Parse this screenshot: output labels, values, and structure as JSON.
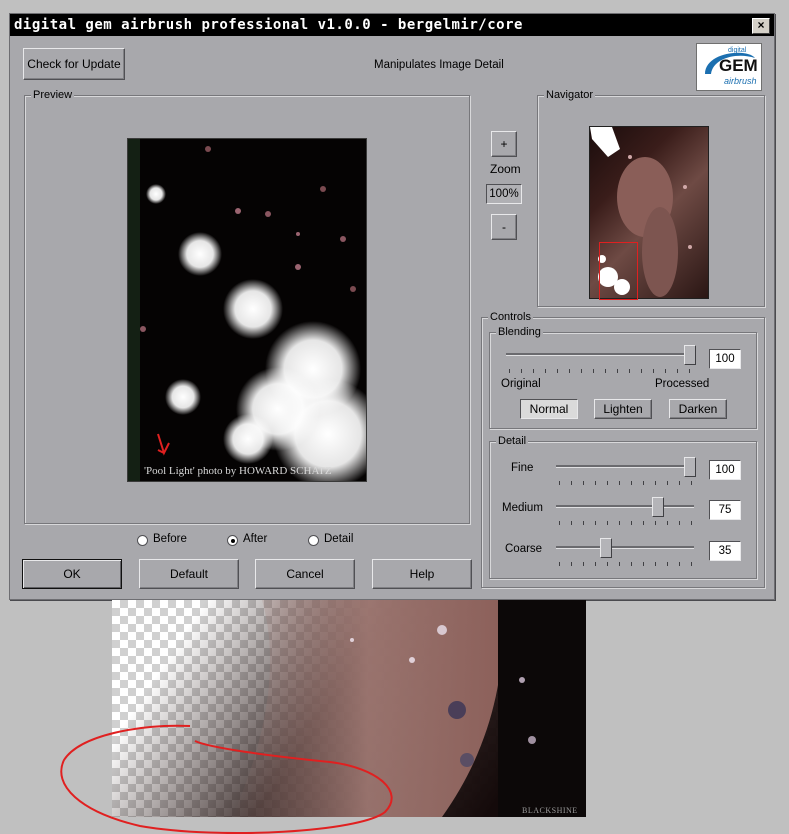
{
  "window": {
    "title": "digital gem airbrush professional v1.0.0 - bergelmir/core",
    "close_glyph": "×"
  },
  "header": {
    "check_update_label": "Check for Update",
    "subtitle": "Manipulates Image Detail"
  },
  "logo": {
    "small_text": "digital",
    "brand": "GEM",
    "sub": "airbrush",
    "accent": "#1b6fb0"
  },
  "preview": {
    "label": "Preview",
    "caption": "'Pool Light' photo by HOWARD SCHATZ"
  },
  "zoom": {
    "label": "Zoom",
    "plus": "+",
    "minus": "-",
    "value": "100%"
  },
  "navigator": {
    "label": "Navigator"
  },
  "controls": {
    "label": "Controls",
    "blending": {
      "label": "Blending",
      "value": "100",
      "level": 1.0,
      "left_label": "Original",
      "right_label": "Processed",
      "modes": [
        "Normal",
        "Lighten",
        "Darken"
      ],
      "selected_mode": "Normal"
    },
    "detail": {
      "label": "Detail",
      "fine": {
        "label": "Fine",
        "value": "100",
        "level": 1.0
      },
      "medium": {
        "label": "Medium",
        "value": "75",
        "level": 0.75
      },
      "coarse": {
        "label": "Coarse",
        "value": "35",
        "level": 0.35
      }
    }
  },
  "view_mode": {
    "options": [
      "Before",
      "After",
      "Detail"
    ],
    "selected": "After"
  },
  "buttons": {
    "ok": "OK",
    "default": "Default",
    "cancel": "Cancel",
    "help": "Help"
  },
  "bottom_image": {
    "watermark": "BLACKSHINE",
    "annotation_color": "#e02020"
  }
}
